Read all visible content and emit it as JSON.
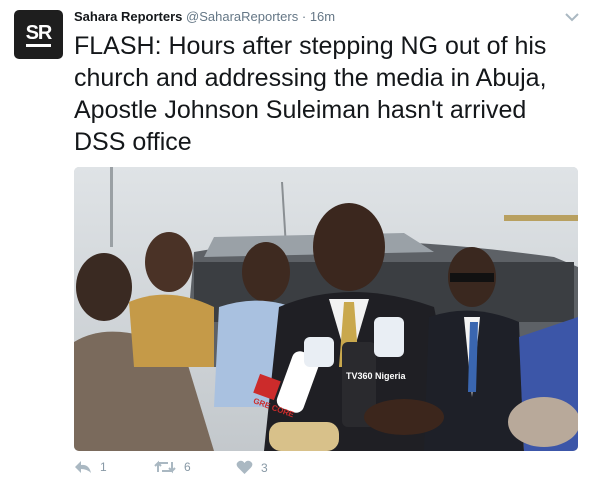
{
  "tweet": {
    "avatar_text": "SR",
    "fullname": "Sahara Reporters",
    "username": "@SaharaReporters",
    "separator": "·",
    "time": "16m",
    "text": "FLASH: Hours after stepping NG out of his church and addressing the media in Abuja, Apostle Johnson Suleiman hasn't arrived DSS office"
  },
  "media": {
    "mic_labels": [
      "TV360 Nigeria",
      "GRE CORE"
    ]
  },
  "actions": {
    "reply_count": "1",
    "retweet_count": "6",
    "like_count": "3"
  },
  "icons": [
    "dropdown-chevron-icon",
    "reply-icon",
    "retweet-icon",
    "heart-icon"
  ],
  "colors": {
    "text": "#14171a",
    "secondary": "#657786",
    "action": "#8899a6"
  }
}
